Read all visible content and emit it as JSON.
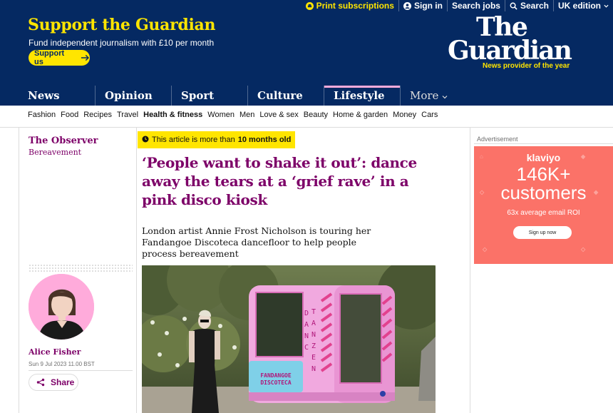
{
  "topbar": {
    "print": "Print subscriptions",
    "signin": "Sign in",
    "jobs": "Search jobs",
    "search": "Search",
    "edition": "UK edition"
  },
  "support": {
    "title": "Support the Guardian",
    "subtitle": "Fund independent journalism with £10 per month",
    "button": "Support us"
  },
  "logo": {
    "line1": "The",
    "line2": "Guardian",
    "tagline": "News provider of the year"
  },
  "pillars": [
    "News",
    "Opinion",
    "Sport",
    "Culture",
    "Lifestyle"
  ],
  "pillars_more": "More",
  "subnav": [
    "Fashion",
    "Food",
    "Recipes",
    "Travel",
    "Health & fitness",
    "Women",
    "Men",
    "Love & sex",
    "Beauty",
    "Home & garden",
    "Money",
    "Cars"
  ],
  "series": {
    "title": "The Observer",
    "subtitle": "Bereavement"
  },
  "age_warning": {
    "prefix": "This article is more than",
    "age": "10 months old"
  },
  "article": {
    "headline": "‘People want to shake it out’: dance away the tears at a ‘grief rave’ in a pink disco kiosk",
    "standfirst": "London artist Annie Frost Nicholson is touring her Fandangoe Discoteca dancefloor to help people process bereavement",
    "author": "Alice Fisher",
    "date": "Sun 9 Jul 2023 11.00 BST",
    "share": "Share"
  },
  "photo": {
    "kiosk_sign": "FANDANGOE DISCOTECA",
    "kiosk_word1": "DANC",
    "kiosk_word2": "TANZEN"
  },
  "ad": {
    "label": "Advertisement",
    "brand": "klaviyo",
    "headline_line1": "146K+",
    "headline_line2": "customers",
    "roi": "63x average email ROI",
    "cta": "Sign up now"
  },
  "colors": {
    "brand": "#052962",
    "accent": "#ffe500",
    "lifestyle": "#7d0068",
    "lifestyle_light": "#ffabdb"
  }
}
